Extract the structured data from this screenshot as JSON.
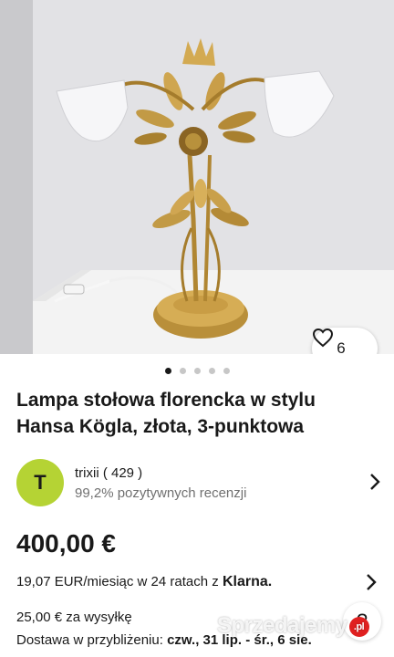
{
  "listing": {
    "like_count": "6",
    "image_count": 5,
    "active_image": 0,
    "title": "Lampa stołowa florencka w stylu Hansa Kögla, złota, 3-punktowa"
  },
  "seller": {
    "avatar_letter": "T",
    "avatar_color": "#b5d334",
    "name": "trixii ( 429 )",
    "feedback": "99,2% pozytywnych recenzji"
  },
  "pricing": {
    "price": "400,00 €",
    "installment_text": "19,07 EUR/miesiąc w 24 ratach z ",
    "installment_brand": "Klarna."
  },
  "shipping": {
    "cost": "25,00 € za wysyłkę",
    "delivery_label": "Dostawa w przybliżeniu: ",
    "delivery_dates": "czw., 31 lip. - śr., 6 sie."
  },
  "overlay": {
    "help_icon": "?",
    "watermark": "Sprzedajemy",
    "watermark_badge": ".pl"
  },
  "icons": {
    "like": "heart-icon",
    "chevron": "chevron-right-icon"
  }
}
